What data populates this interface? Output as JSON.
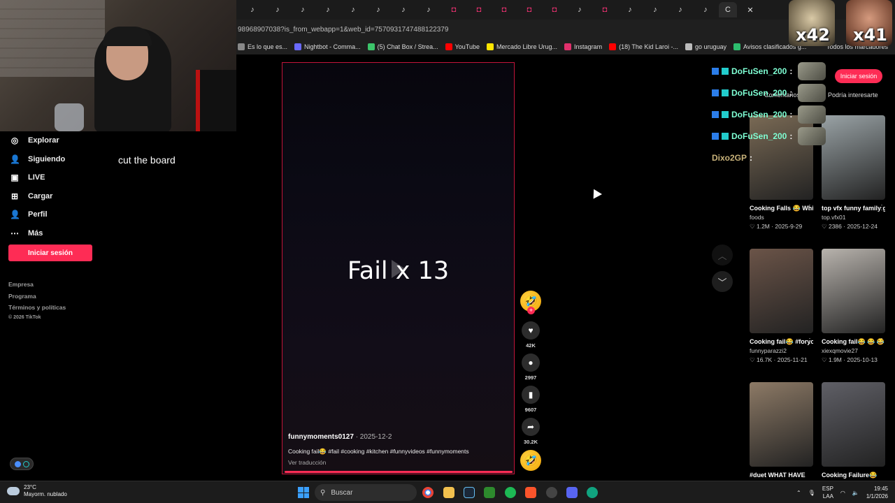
{
  "browser": {
    "url": "98968907038?is_from_webapp=1&web_id=7570931747488122379",
    "bookmarks": [
      {
        "label": "Es lo que es...",
        "color": "#888888"
      },
      {
        "label": "Nightbot - Comma...",
        "color": "#6a6aff"
      },
      {
        "label": "(5) Chat Box / Strea...",
        "color": "#3cc46a"
      },
      {
        "label": "YouTube",
        "color": "#ff0000"
      },
      {
        "label": "Mercado Libre Urug...",
        "color": "#ffe600"
      },
      {
        "label": "Instagram",
        "color": "#e1306c"
      },
      {
        "label": "(18) The Kid Laroi -...",
        "color": "#ff0000"
      },
      {
        "label": "go uruguay",
        "color": "#bbbbbb"
      },
      {
        "label": "Avisos clasificados g...",
        "color": "#2dbd6e"
      }
    ],
    "all_bookmarks": "Todos los marcadores",
    "tab_icons": [
      "tiktok",
      "tiktok",
      "tiktok",
      "tiktok",
      "tiktok",
      "tiktok",
      "tiktok",
      "tiktok",
      "instagram",
      "instagram",
      "instagram",
      "instagram",
      "instagram",
      "tiktok",
      "instagram",
      "tiktok",
      "tiktok",
      "tiktok",
      "tiktok"
    ],
    "active_tab": "C"
  },
  "emotes": [
    {
      "count": "x42"
    },
    {
      "count": "x41"
    }
  ],
  "sidebar": {
    "items": [
      {
        "label": "Explorar",
        "icon": "compass-icon",
        "glyph": "◎"
      },
      {
        "label": "Siguiendo",
        "icon": "user-follow-icon",
        "glyph": "👤"
      },
      {
        "label": "LIVE",
        "icon": "live-icon",
        "glyph": "▣"
      },
      {
        "label": "Cargar",
        "icon": "upload-icon",
        "glyph": "⊞"
      },
      {
        "label": "Perfil",
        "icon": "profile-icon",
        "glyph": "👤"
      },
      {
        "label": "Más",
        "icon": "more-icon",
        "glyph": "⋯"
      }
    ],
    "login_button": "Iniciar sesión",
    "footer": {
      "empresa": "Empresa",
      "programa": "Programa",
      "terminos": "Términos y políticas",
      "copyright": "© 2026 TikTok"
    }
  },
  "caption_overlay": "cut the board",
  "video": {
    "title": "Fail x 13",
    "author": "funnymoments0127",
    "date": " · 2025-12-2",
    "description": "Cooking fail😂 #fail #cooking #kitchen #funnyvideos #funnymoments",
    "translate": "Ver traducción"
  },
  "actions": {
    "likes": "42K",
    "comments": "2997",
    "saves": "9607",
    "shares": "30.2K"
  },
  "chat": [
    {
      "user": "DoFuSen_200",
      "sep": ":"
    },
    {
      "user": "DoFuSen_200",
      "sep": ":"
    },
    {
      "user": "DoFuSen_200",
      "sep": ":"
    },
    {
      "user": "DoFuSen_200",
      "sep": ":"
    },
    {
      "user": "Dixo2GP",
      "sep": ":"
    }
  ],
  "right_panel": {
    "login_button": "Iniciar sesión",
    "tab_comments": "Comentarios",
    "tab_interest": "Podría interesarte",
    "cards": [
      {
        "title": "Cooking Falls 😂 Which one is you...",
        "author": "foods",
        "stats": "♡ 1.2M · 2025-9-29",
        "color": "#7a6a55"
      },
      {
        "title": "top vfx funny family gaming...",
        "author": "top.vfx01",
        "stats": "♡ 2386 · 2025-12-24",
        "color": "#9aa3a6"
      },
      {
        "title": "Cooking fail😂 #foryour #cook...",
        "author": "funnyparazzi2",
        "stats": "♡ 16.7K · 2025-11-21",
        "color": "#6b5448"
      },
      {
        "title": "Cooking fail😂 😂 😂 #foryour #co...",
        "author": "xiexqmovie27",
        "stats": "♡ 1.9M · 2025-10-13",
        "color": "#b8b3ad"
      },
      {
        "title": "#duet WHAT HAVE",
        "author": "",
        "stats": "",
        "color": "#8d7a66"
      },
      {
        "title": "Cooking Failure😂",
        "author": "",
        "stats": "",
        "color": "#5f5f66"
      }
    ]
  },
  "taskbar": {
    "temp": "23°C",
    "weather": "Mayorm. nublado",
    "search": "Buscar",
    "lang_top": "ESP",
    "lang_bottom": "LAA",
    "time": "19:45",
    "date": "1/1/2026"
  }
}
